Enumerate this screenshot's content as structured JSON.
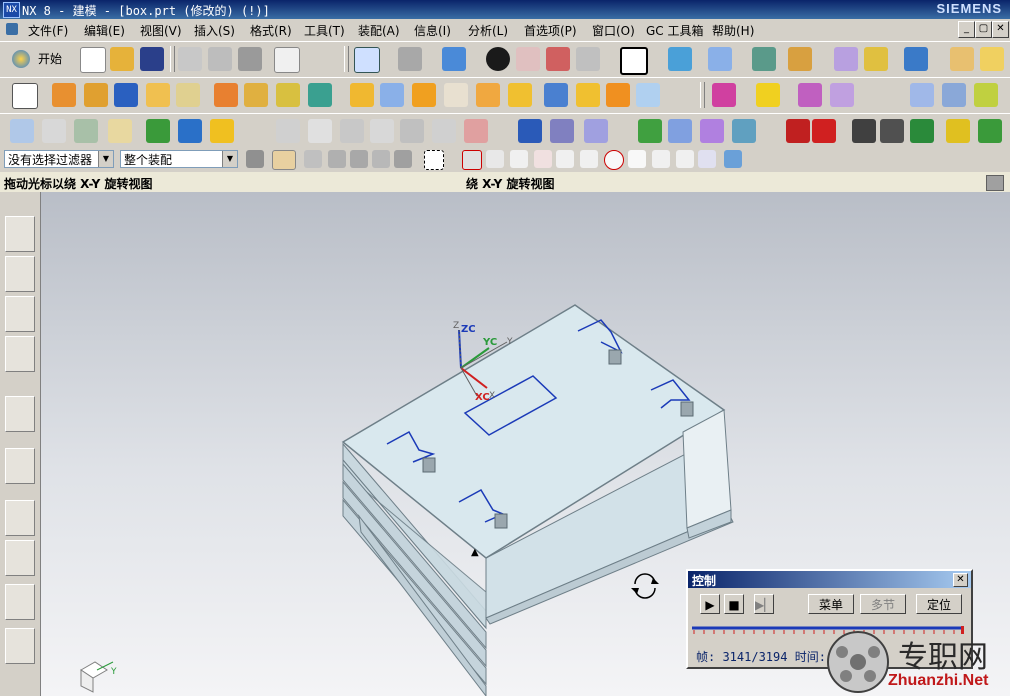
{
  "window": {
    "title": "NX 8 - 建模 - [box.prt (修改的)     (!)]",
    "brand": "SIEMENS",
    "controls": [
      "_",
      "▢",
      "✕"
    ]
  },
  "menu": [
    "文件(F)",
    "编辑(E)",
    "视图(V)",
    "插入(S)",
    "格式(R)",
    "工具(T)",
    "装配(A)",
    "信息(I)",
    "分析(L)",
    "首选项(P)",
    "窗口(O)",
    "GC 工具箱",
    "帮助(H)"
  ],
  "toolbar": {
    "start_label": "开始"
  },
  "selection": {
    "filter": "没有选择过滤器",
    "scope": "整个装配"
  },
  "cue": {
    "left": "拖动光标以绕 X-Y 旋转视图",
    "right": "绕 X-Y 旋转视图"
  },
  "triad": {
    "zc": "ZC",
    "yc": "YC",
    "xc": "XC",
    "z": "Z",
    "y": "Y",
    "x": "X"
  },
  "control_panel": {
    "title": "控制",
    "menu_btn": "菜单",
    "step_btn": "多节",
    "locate_btn": "定位",
    "frame_text": "帧: 3141/3194 时间:"
  },
  "watermark": {
    "zh": "专职网",
    "en": "Zhuanzhi.Net"
  },
  "colors": {
    "model_face": "#d9e8ee",
    "model_edge": "#6e7f88",
    "sketch": "#1b3ab8"
  }
}
